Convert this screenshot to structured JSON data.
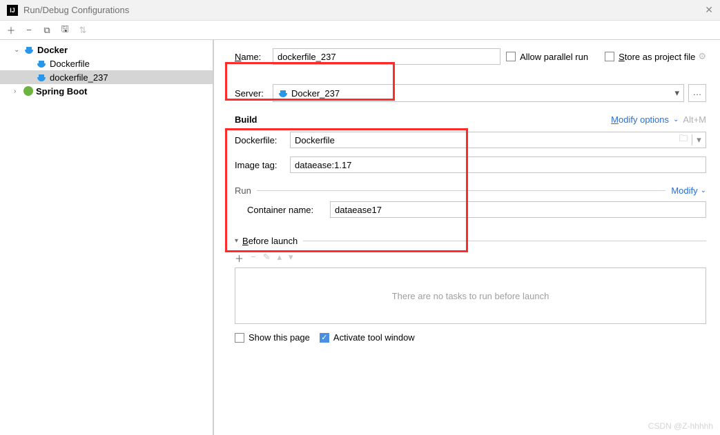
{
  "window": {
    "title": "Run/Debug Configurations"
  },
  "tree": {
    "docker": "Docker",
    "dockerfile": "Dockerfile",
    "dockerfile237": "dockerfile_237",
    "springboot": "Spring Boot"
  },
  "form": {
    "name_label": "Name:",
    "name_value": "dockerfile_237",
    "allow_parallel": "Allow parallel run",
    "store_as_project": "Store as project file",
    "server_label": "Server:",
    "server_value": "Docker_237"
  },
  "build": {
    "title": "Build",
    "modify_options": "Modify options",
    "shortcut": "Alt+M",
    "dockerfile_label": "Dockerfile:",
    "dockerfile_value": "Dockerfile",
    "image_tag_label": "Image tag:",
    "image_tag_value": "dataease:1.17"
  },
  "run": {
    "title": "Run",
    "modify": "Modify",
    "container_label": "Container name:",
    "container_value": "dataease17"
  },
  "before": {
    "title": "Before launch",
    "empty": "There are no tasks to run before launch"
  },
  "bottom": {
    "show_page": "Show this page",
    "activate": "Activate tool window"
  },
  "watermark": "CSDN @Z-hhhhh"
}
